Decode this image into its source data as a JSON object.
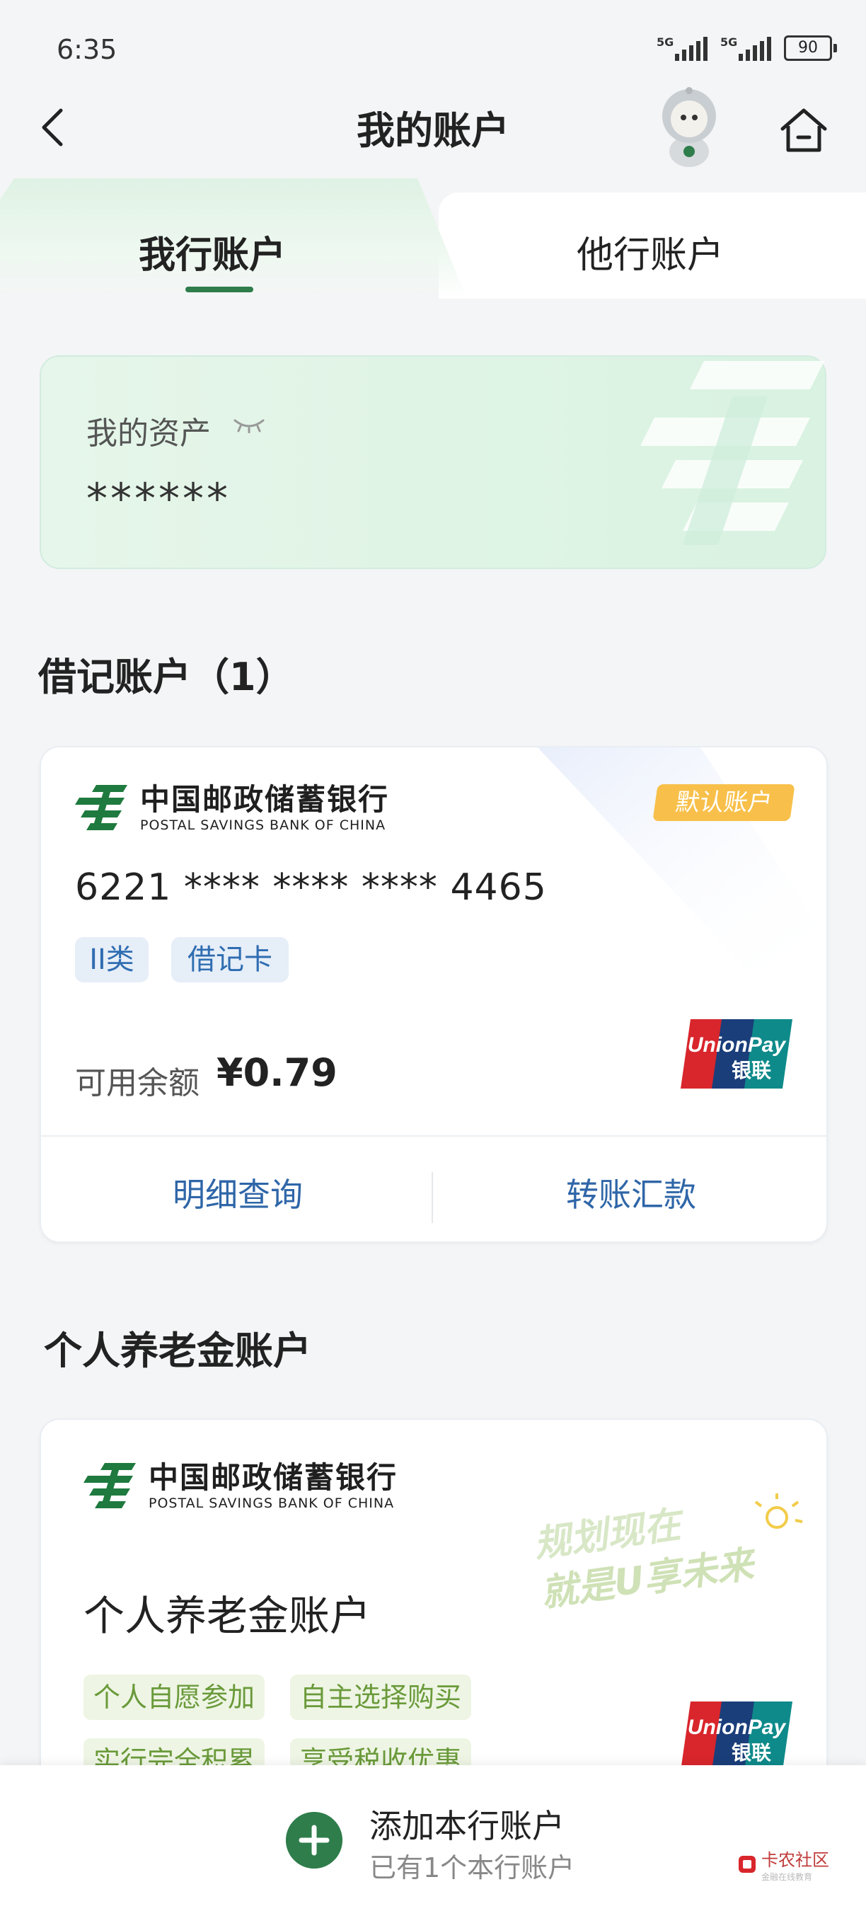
{
  "status_bar": {
    "time": "6:35",
    "signal1": "5G",
    "signal2": "5G",
    "battery": "90"
  },
  "header": {
    "title": "我的账户"
  },
  "tabs": [
    {
      "label": "我行账户"
    },
    {
      "label": "他行账户"
    }
  ],
  "assets": {
    "label": "我的资产",
    "value": "******"
  },
  "debit_section": {
    "title": "借记账户（1）",
    "card": {
      "bank_name_zh": "中国邮政储蓄银行",
      "bank_name_en": "POSTAL SAVINGS BANK OF CHINA",
      "badge": "默认账户",
      "number": "6221 **** **** **** 4465",
      "tags": [
        "II类",
        "借记卡"
      ],
      "balance_label": "可用余额",
      "balance": "¥0.79",
      "actions": [
        "明细查询",
        "转账汇款"
      ]
    }
  },
  "pension_section": {
    "title": "个人养老金账户",
    "card": {
      "bank_name_zh": "中国邮政储蓄银行",
      "bank_name_en": "POSTAL SAVINGS BANK OF CHINA",
      "slogan_line1": "规划现在",
      "slogan_line2": "就是U享未来",
      "name": "个人养老金账户",
      "tags": [
        "个人自愿参加",
        "自主选择购买",
        "实行完全积累",
        "享受税收优惠"
      ]
    }
  },
  "bottom_bar": {
    "add_title": "添加本行账户",
    "add_subtitle": "已有1个本行账户"
  },
  "watermark": {
    "text": "卡农社区",
    "sub": "金融在线教育"
  },
  "unionpay": {
    "line1": "UnionPay",
    "line2": "银联"
  },
  "colors": {
    "brand_green": "#2e7d4b",
    "link_blue": "#2f66a8",
    "badge_yellow": "#f8c04a"
  }
}
